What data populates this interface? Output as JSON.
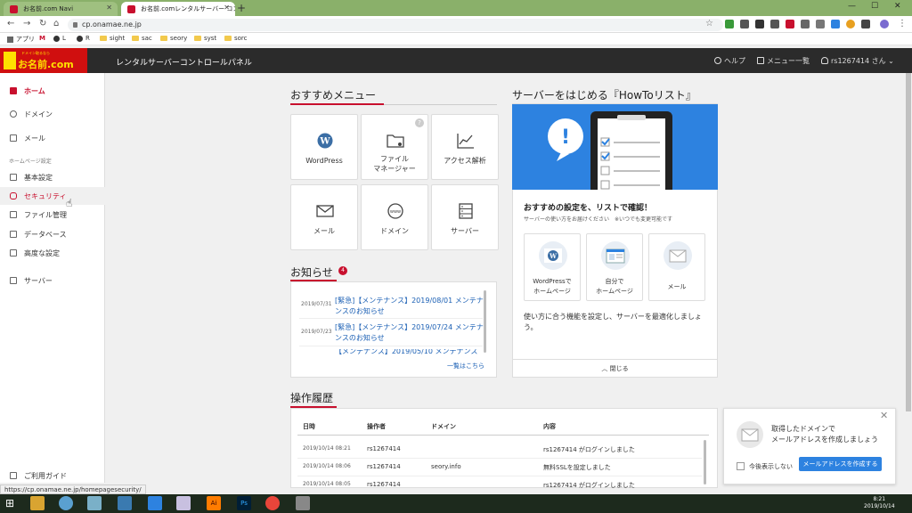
{
  "browser": {
    "tabs": [
      {
        "title": "お名前.com Navi"
      },
      {
        "title": "お名前.comレンタルサーバー コントロ"
      }
    ],
    "url": "cp.onamae.ne.jp",
    "bookmarks": [
      "アプリ",
      "M",
      "L",
      "R",
      "sight",
      "sac",
      "seory",
      "syst",
      "sorc"
    ],
    "status_url": "https://cp.onamae.ne.jp/homepagesecurity/"
  },
  "header": {
    "logo_text": "お名前.com",
    "logo_small": "ドメイン取るなら",
    "title": "レンタルサーバーコントロールパネル",
    "help": "ヘルプ",
    "menu_list": "メニュー一覧",
    "user": "rs1267414 さん"
  },
  "sidebar": {
    "items": [
      {
        "label": "ホーム"
      },
      {
        "label": "ドメイン"
      },
      {
        "label": "メール"
      },
      {
        "label": "基本設定"
      },
      {
        "label": "セキュリティ"
      },
      {
        "label": "ファイル管理"
      },
      {
        "label": "データベース"
      },
      {
        "label": "高度な設定"
      },
      {
        "label": "サーバー"
      }
    ],
    "section_label": "ホームページ設定",
    "guide": "ご利用ガイド"
  },
  "recommended": {
    "title": "おすすめメニュー",
    "cards": [
      {
        "label": "WordPress"
      },
      {
        "label": "ファイル\nマネージャー"
      },
      {
        "label": "アクセス解析"
      },
      {
        "label": "メール"
      },
      {
        "label": "ドメイン"
      },
      {
        "label": "サーバー"
      }
    ]
  },
  "news": {
    "title": "お知らせ",
    "badge": "4",
    "items": [
      {
        "date": "2019/07/31",
        "title": "[緊急]【メンテナンス】2019/08/01 メンテナンスのお知らせ"
      },
      {
        "date": "2019/07/23",
        "title": "[緊急]【メンテナンス】2019/07/24 メンテナンスのお知らせ"
      },
      {
        "date": "",
        "title": "【メンテナンス】2019/05/10 メンテナンス"
      }
    ],
    "more": "一覧はこちら"
  },
  "howto": {
    "title": "サーバーをはじめる『HowToリスト』",
    "heading": "おすすめの設定を、リストで確認！",
    "sub": "サーバーの使い方をお届けください　※いつでも変更可能です",
    "cards": [
      {
        "label": "WordPressで\nホームページ"
      },
      {
        "label": "自分で\nホームページ"
      },
      {
        "label": "メール"
      }
    ],
    "desc": "使い方に合う機能を設定し、サーバーを最適化しましょう。",
    "close": "閉じる"
  },
  "history": {
    "title": "操作履歴",
    "columns": [
      "日時",
      "操作者",
      "ドメイン",
      "内容"
    ],
    "rows": [
      {
        "datetime": "2019/10/14 08:21",
        "operator": "rs1267414",
        "domain": "",
        "content": "rs1267414 がログインしました"
      },
      {
        "datetime": "2019/10/14 08:06",
        "operator": "rs1267414",
        "domain": "seory.info",
        "content": "無料SSLを設定しました"
      },
      {
        "datetime": "2019/10/14 08:05",
        "operator": "rs1267414",
        "domain": "",
        "content": "rs1267414 がログインしました"
      }
    ]
  },
  "popup": {
    "text": "取得したドメインで\nメールアドレスを作成しましょう",
    "checkbox": "今後表示しない",
    "button": "メールアドレスを作成する"
  },
  "taskbar": {
    "time": "8:21",
    "date": "2019/10/14"
  },
  "colors": {
    "brand": "#c8102e",
    "accent": "#2d82e0",
    "header": "#2b2b2b"
  }
}
